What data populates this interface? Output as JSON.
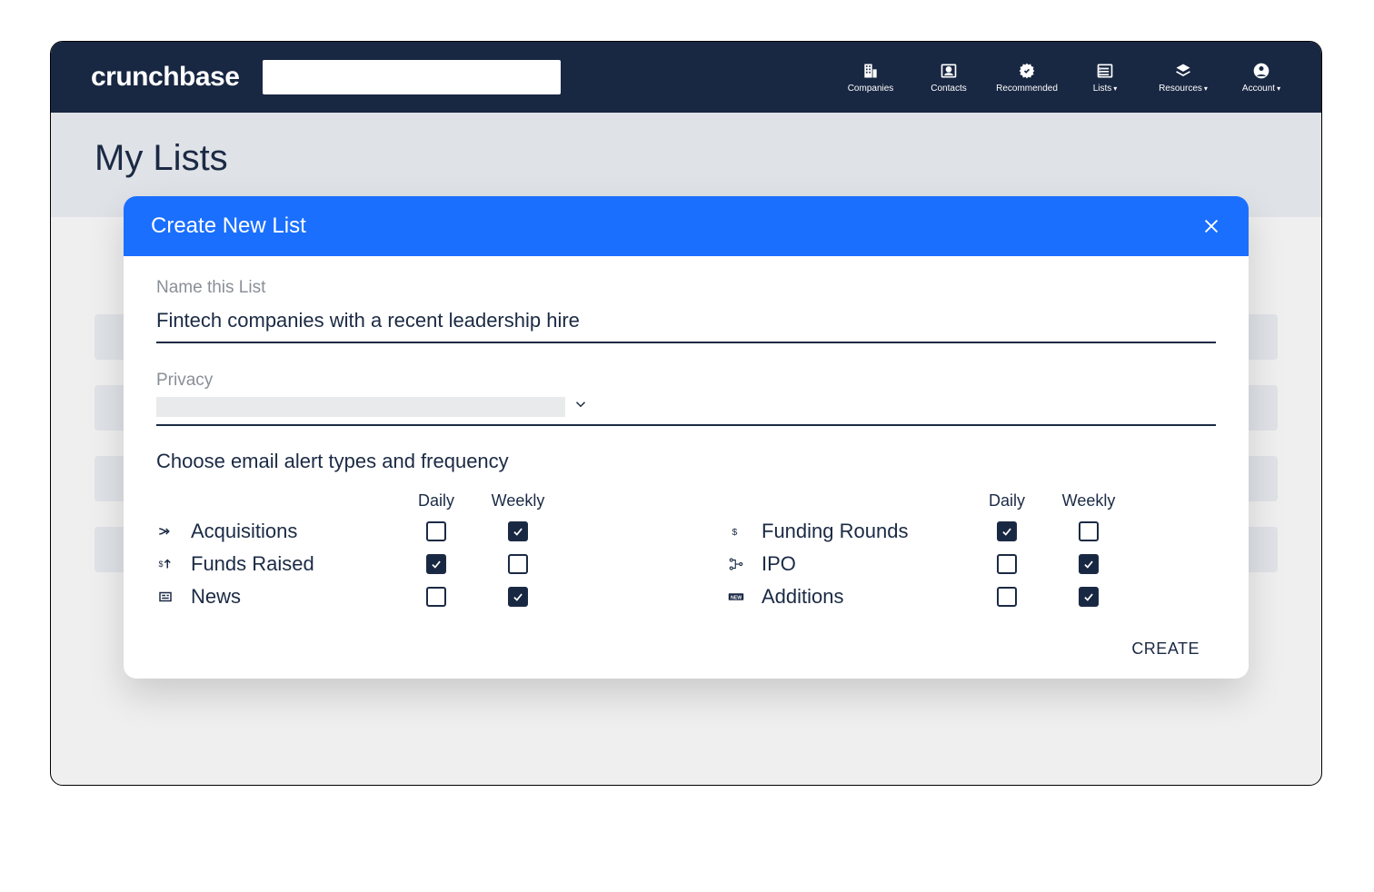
{
  "brand": "crunchbase",
  "nav": {
    "items": [
      {
        "id": "companies",
        "label": "Companies",
        "icon": "building-icon",
        "dropdown": false
      },
      {
        "id": "contacts",
        "label": "Contacts",
        "icon": "contact-card-icon",
        "dropdown": false
      },
      {
        "id": "recommended",
        "label": "Recommended",
        "icon": "badge-check-icon",
        "dropdown": false
      },
      {
        "id": "lists",
        "label": "Lists",
        "icon": "list-icon",
        "dropdown": true
      },
      {
        "id": "resources",
        "label": "Resources",
        "icon": "layers-icon",
        "dropdown": true
      },
      {
        "id": "account",
        "label": "Account",
        "icon": "user-circle-icon",
        "dropdown": true
      }
    ]
  },
  "page": {
    "title": "My Lists"
  },
  "modal": {
    "title": "Create New List",
    "name_label": "Name this List",
    "name_value": "Fintech companies with a recent leadership hire",
    "privacy_label": "Privacy",
    "alerts_heading": "Choose email alert types and frequency",
    "freq_headers": [
      "Daily",
      "Weekly"
    ],
    "alerts_left": [
      {
        "id": "acquisitions",
        "label": "Acquisitions",
        "icon": "merge-icon",
        "daily": false,
        "weekly": true
      },
      {
        "id": "funds-raised",
        "label": "Funds Raised",
        "icon": "dollar-up-icon",
        "daily": true,
        "weekly": false
      },
      {
        "id": "news",
        "label": "News",
        "icon": "news-icon",
        "daily": false,
        "weekly": true
      }
    ],
    "alerts_right": [
      {
        "id": "funding-rounds",
        "label": "Funding Rounds",
        "icon": "dollar-icon",
        "daily": true,
        "weekly": false
      },
      {
        "id": "ipo",
        "label": "IPO",
        "icon": "org-chart-icon",
        "daily": false,
        "weekly": true
      },
      {
        "id": "additions",
        "label": "Additions",
        "icon": "new-badge-icon",
        "daily": false,
        "weekly": true
      }
    ],
    "create_label": "CREATE"
  }
}
